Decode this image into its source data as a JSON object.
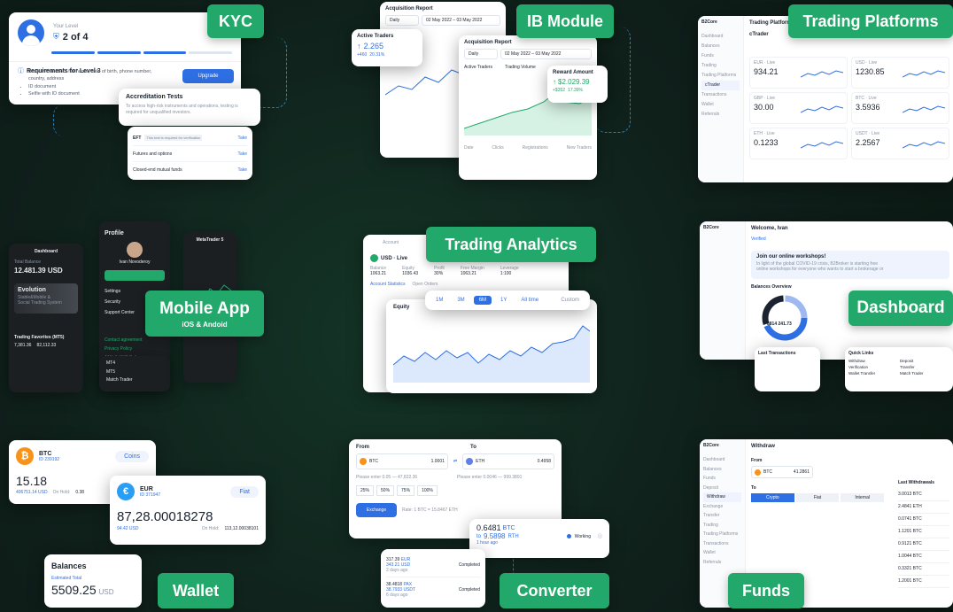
{
  "tags": {
    "kyc": "KYC",
    "ib": "IB Module",
    "trading_platforms": "Trading Platforms",
    "trading_analytics": "Trading Analytics",
    "mobile_app": "Mobile App",
    "mobile_sub": "iOS & Andoid",
    "dashboard": "Dashboard",
    "wallet": "Wallet",
    "converter": "Converter",
    "funds": "Funds"
  },
  "kyc": {
    "your_level": "Your Level",
    "level": "2 of 4",
    "req_title": "Requirements for Level 3",
    "req_items": [
      "Basic information: full name, date of birth, phone number, country, address",
      "ID document",
      "Selfie with ID document"
    ],
    "upgrade": "Upgrade",
    "accred_title": "Accreditation Tests",
    "accred_text": "To access high-risk instruments and operations, testing is required for unqualified investors.",
    "tests": [
      {
        "name": "EFT",
        "note": "This test is required for verification",
        "action": "Take"
      },
      {
        "name": "Futures and options",
        "note": "",
        "action": "Take"
      },
      {
        "name": "Closed-end mutual funds",
        "note": "",
        "action": "Take"
      }
    ]
  },
  "ib": {
    "report_title": "Acquisition Report",
    "period": "Daily",
    "date_range": "02 May 2022 – 03 May 2022",
    "active_traders": "Active Traders",
    "active_value": "2.265",
    "active_change": "+460",
    "active_pct": "20.31%",
    "trading_volume": "Trading Volume",
    "reward_label": "Reward Amount",
    "reward_value": "$2.029.39",
    "reward_change": "+$352",
    "reward_pct": "17.39%",
    "table_headers": [
      "Date",
      "Clicks",
      "Registrations",
      "New Traders"
    ]
  },
  "platforms": {
    "logo": "B2Core",
    "header": "Trading Platforms",
    "sub": "cTrader",
    "nav": [
      "Dashboard",
      "Balances",
      "Funds",
      "Trading",
      "Trading Platforms",
      "cTrader",
      "Transactions",
      "Wallet",
      "Referrals"
    ],
    "accounts": [
      {
        "name": "EUR · Live",
        "value": "934.21",
        "change": "+3.2%"
      },
      {
        "name": "USD · Live",
        "value": "1230.85",
        "change": "+1.4%"
      },
      {
        "name": "GBP · Live",
        "value": "30.00",
        "change": "+0.8%"
      },
      {
        "name": "BTC · Live",
        "value": "3.5936",
        "change": "+2.1%"
      },
      {
        "name": "ETH · Live",
        "value": "0.1233",
        "change": "+0.5%"
      },
      {
        "name": "USDT · Live",
        "value": "2.2567",
        "change": "+1.1%"
      }
    ]
  },
  "mobile": {
    "dashboard": "Dashboard",
    "total_balance": "Total Balance",
    "balance": "12.481.39 USD",
    "evolution": "Evolution",
    "evo_sub": "Stable&Mobile & Social Trading System",
    "trading_favorites": "Trading Favorites (MT5)",
    "fav_values": [
      "7,381.36",
      "82,112.33"
    ],
    "profile": "Profile",
    "profile_name": "Ivan Novoderoy",
    "profile_menu": [
      "Settings",
      "Security",
      "Support Center"
    ],
    "platform_menu": [
      "MT4",
      "MT5",
      "Match Trader"
    ],
    "metatrader": "MetaTrader 5",
    "profile_links": [
      "Contact agreement",
      "Privacy Policy",
      "AML & KYC Policy"
    ]
  },
  "analytics": {
    "account_label": "Account",
    "account_name": "USD · Live",
    "cols": [
      "Balance",
      "Equity",
      "Profit",
      "Free Margin",
      "Leverage"
    ],
    "vals": [
      "1063.21",
      "1036.43",
      "30%",
      "1063.21",
      "1:100"
    ],
    "tabs": [
      "Account Statistics",
      "Open Orders"
    ],
    "equity_title": "Equity",
    "ranges": [
      "1M",
      "3M",
      "6M",
      "1Y",
      "All time",
      "Custom"
    ],
    "active_range": "6M"
  },
  "dashboard": {
    "logo": "B2Core",
    "welcome": "Welcome, Ivan",
    "verified": "Verified",
    "banner_title": "Join our online workshops!",
    "banner_text": "In light of the global COVID-19 crisis, B2Broker is starting free online workshops for everyone who wants to start a brokerage or exchange business.",
    "banner_btn": "See Details",
    "balances_overview": "Balances Overview",
    "total": "8814 241.73",
    "legend": [
      "EUR",
      "BTC",
      "ETH",
      "USD"
    ],
    "last_tx": "Last Transactions",
    "quick_links": "Quick Links",
    "quick_items": [
      "Withdraw",
      "Deposit",
      "Verification",
      "Transfer",
      "Wallet Transfer",
      "Match Trader"
    ]
  },
  "wallet": {
    "btc_name": "BTC",
    "btc_id": "ID 239192",
    "btc_badge": "Coins",
    "btc_value": "15.18",
    "btc_usd": "406751.14 USD",
    "btc_hold_label": "On Hold:",
    "btc_hold": "0.38",
    "eur_name": "EUR",
    "eur_id": "ID 371947",
    "eur_badge": "Fiat",
    "eur_value": "87,28.00018278",
    "eur_usd": "94.42 USD",
    "eur_hold_label": "On Hold:",
    "eur_hold": "113,12.00038101",
    "balances_title": "Balances",
    "estimated": "Estimated Total",
    "est_value": "5509.25",
    "est_cur": "USD"
  },
  "converter": {
    "from": "From",
    "to": "To",
    "from_cur": "BTC",
    "from_amt": "1.0001",
    "to_cur": "ETH",
    "to_amt": "0.4958",
    "hint_from": "Please enter 0.05 — 47,822.36",
    "hint_to": "Please enter 0.0046 — 999.3891",
    "pcts": [
      "25%",
      "50%",
      "75%",
      "100%"
    ],
    "exchange": "Exchange",
    "rate": "Rate: 1 BTC = 15.8467 ETH",
    "result_from": "0.6481",
    "result_from_cur": "BTC",
    "result_to_prefix": "to",
    "result_to": "9.5898",
    "result_to_cur": "RTH",
    "result_time": "1 hour ago",
    "status_working": "Working",
    "history": [
      {
        "from": "317.39",
        "from_cur": "EUR",
        "to": "343.21",
        "to_cur": "USD",
        "time": "2 days ago",
        "status": "Completed"
      },
      {
        "from": "38.4818",
        "from_cur": "PAX",
        "to": "38.7933",
        "to_cur": "USDT",
        "time": "6 days ago",
        "status": "Completed"
      }
    ]
  },
  "funds": {
    "logo": "B2Core",
    "title": "Withdraw",
    "from": "From",
    "to": "To",
    "currency": "BTC",
    "amount": "41.2861",
    "tabs": [
      "Crypto",
      "Fiat",
      "Internal"
    ],
    "last_withdrawals": "Last Withdrawals",
    "nav": [
      "Dashboard",
      "Balances",
      "Funds",
      "Deposit",
      "Withdraw",
      "Exchange",
      "Transfer",
      "Trading",
      "Trading Platforms",
      "Transactions",
      "Wallet",
      "Referrals"
    ],
    "withdrawals": [
      "3.0013 BTC",
      "2.4841 ETH",
      "0.0741 BTC",
      "1.1201 BTC",
      "0.9121 BTC",
      "1.0044 BTC",
      "0.3321 BTC",
      "1.2001 BTC"
    ]
  }
}
